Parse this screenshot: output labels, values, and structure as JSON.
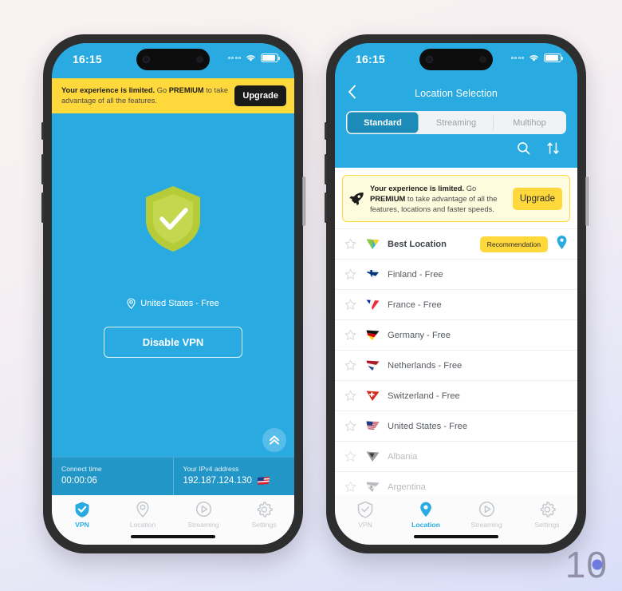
{
  "statusbar": {
    "time": "16:15"
  },
  "left_phone": {
    "banner": {
      "text_bold": "Your experience is limited.",
      "text_mid": " Go ",
      "text_premium": "PREMIUM",
      "text_end": " to take advantage of all the features.",
      "upgrade_label": "Upgrade"
    },
    "shield_icon": "shield-check-icon",
    "location_label": "United States - Free",
    "location_pin_icon": "map-pin-icon",
    "disable_button": "Disable VPN",
    "scroll_up_icon": "double-chevron-up-icon",
    "info": {
      "connect_time_label": "Connect time",
      "connect_time_value": "00:00:06",
      "ip_label": "Your IPv4 address",
      "ip_value": "192.187.124.130",
      "ip_flag": "us-flag-icon"
    },
    "tabs": [
      {
        "label": "VPN",
        "icon": "shield-icon",
        "active": true
      },
      {
        "label": "Location",
        "icon": "map-pin-icon",
        "active": false
      },
      {
        "label": "Streaming",
        "icon": "play-circle-icon",
        "active": false
      },
      {
        "label": "Settings",
        "icon": "gear-icon",
        "active": false
      }
    ]
  },
  "right_phone": {
    "nav": {
      "back_icon": "chevron-left-icon",
      "title": "Location Selection"
    },
    "segments": [
      {
        "label": "Standard",
        "active": true
      },
      {
        "label": "Streaming",
        "active": false
      },
      {
        "label": "Multihop",
        "active": false
      }
    ],
    "tools": [
      {
        "name": "search-icon"
      },
      {
        "name": "sort-icon"
      }
    ],
    "promo": {
      "rocket_icon": "rocket-icon",
      "text_bold": "Your experience is limited.",
      "text_mid": " Go ",
      "text_premium": "PREMIUM",
      "text_end": " to take advantage of all the features, locations and faster speeds.",
      "upgrade_label": "Upgrade"
    },
    "locations": [
      {
        "name": "Best Location",
        "flag": "best-location-flag-icon",
        "badge": "Recommendation",
        "pin": true,
        "best": true,
        "locked": false,
        "starred": false
      },
      {
        "name": "Finland - Free",
        "flag": "finland-flag-icon",
        "badge": "",
        "pin": false,
        "best": false,
        "locked": false,
        "starred": false
      },
      {
        "name": "France - Free",
        "flag": "france-flag-icon",
        "badge": "",
        "pin": false,
        "best": false,
        "locked": false,
        "starred": false
      },
      {
        "name": "Germany - Free",
        "flag": "germany-flag-icon",
        "badge": "",
        "pin": false,
        "best": false,
        "locked": false,
        "starred": false
      },
      {
        "name": "Netherlands - Free",
        "flag": "netherlands-flag-icon",
        "badge": "",
        "pin": false,
        "best": false,
        "locked": false,
        "starred": false
      },
      {
        "name": "Switzerland - Free",
        "flag": "switzerland-flag-icon",
        "badge": "",
        "pin": false,
        "best": false,
        "locked": false,
        "starred": false
      },
      {
        "name": "United States - Free",
        "flag": "us-flag-icon",
        "badge": "",
        "pin": false,
        "best": false,
        "locked": false,
        "starred": false
      },
      {
        "name": "Albania",
        "flag": "albania-flag-icon",
        "badge": "",
        "pin": false,
        "best": false,
        "locked": true,
        "starred": false
      },
      {
        "name": "Argentina",
        "flag": "argentina-flag-icon",
        "badge": "",
        "pin": false,
        "best": false,
        "locked": true,
        "starred": false
      }
    ],
    "tabs": [
      {
        "label": "VPN",
        "icon": "shield-icon",
        "active": false
      },
      {
        "label": "Location",
        "icon": "map-pin-icon",
        "active": true
      },
      {
        "label": "Streaming",
        "icon": "play-circle-icon",
        "active": false
      },
      {
        "label": "Settings",
        "icon": "gear-icon",
        "active": false
      }
    ]
  },
  "watermark": {
    "text": "1",
    "zero": "0"
  },
  "colors": {
    "brand_blue": "#29abe2",
    "info_blue": "#2296c7",
    "accent_yellow": "#ffd93b",
    "promo_bg": "#fffbdd",
    "segment_active": "#1c8bb8",
    "shield_green": "#b5cc38"
  }
}
